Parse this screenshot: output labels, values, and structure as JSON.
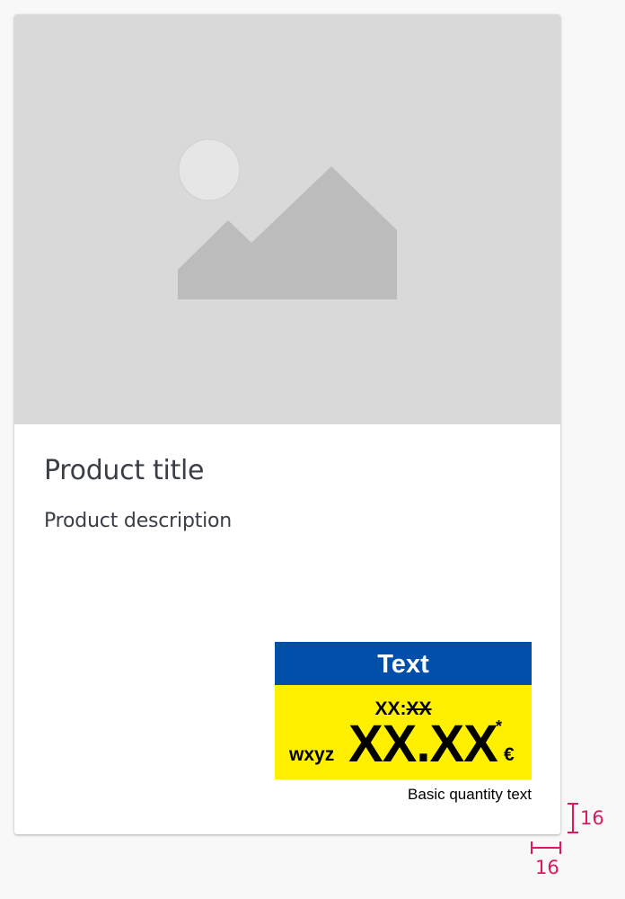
{
  "product": {
    "title": "Product title",
    "description": "Product description"
  },
  "price": {
    "header_label": "Text",
    "old_price_prefix": "XX:",
    "old_price_struck": "XX",
    "unit_prefix": "wxyz",
    "main_price": "XX.XX",
    "asterisk": "*",
    "currency": "€",
    "basic_quantity": "Basic quantity text"
  },
  "annotations": {
    "vertical_spacing_label": "16",
    "horizontal_spacing_label": "16"
  },
  "colors": {
    "page_background": "#f8f8f8",
    "card_background": "#ffffff",
    "image_placeholder": "#d9d9d9",
    "price_header": "#0050aa",
    "price_body": "#fff000",
    "annotation": "#d81b60"
  },
  "icons": {
    "image_placeholder": "image-placeholder-icon"
  }
}
